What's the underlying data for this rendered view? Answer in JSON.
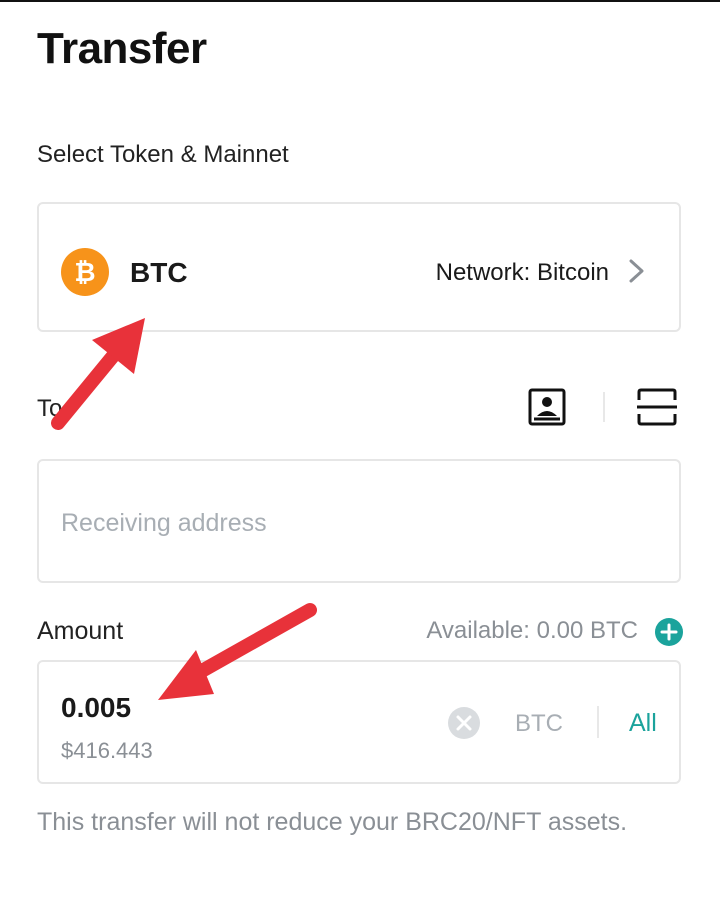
{
  "page": {
    "title": "Transfer"
  },
  "token_section": {
    "label": "Select Token & Mainnet",
    "coin_glyph": "₿",
    "coin_color": "#f7931a",
    "symbol": "BTC",
    "network": "Network: Bitcoin",
    "chevron": "chevron-right-icon"
  },
  "to_section": {
    "label": "To",
    "contacts_icon": "contacts-book-icon",
    "scan_icon": "scan-icon",
    "placeholder": "Receiving address",
    "value": ""
  },
  "amount_section": {
    "label": "Amount",
    "available": "Available: 0.00 BTC",
    "amount": "0.005",
    "fiat": "$416.443",
    "unit": "BTC",
    "all_label": "All",
    "accent_color": "#1ba39c"
  },
  "notice": "This transfer will not reduce your BRC20/NFT assets.",
  "annotation": {
    "arrow_color": "#e8323a"
  }
}
